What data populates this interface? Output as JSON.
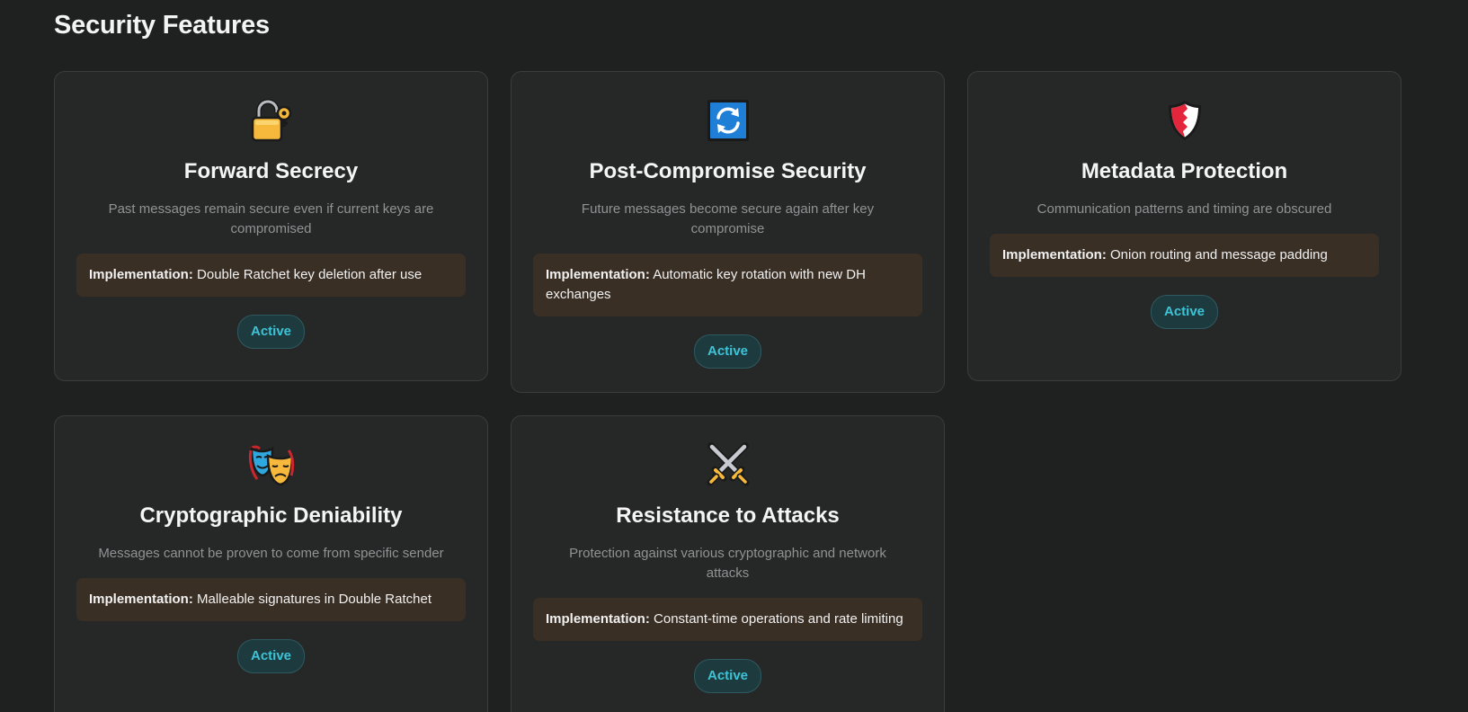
{
  "section": {
    "title": "Security Features"
  },
  "features": [
    {
      "icon": "unlocked-padlock-key-icon",
      "title": "Forward Secrecy",
      "description": "Past messages remain secure even if current keys are compromised",
      "impl_label": "Implementation:",
      "impl_text": "Double Ratchet key deletion after use",
      "status": "Active"
    },
    {
      "icon": "refresh-arrows-icon",
      "title": "Post-Compromise Security",
      "description": "Future messages become secure again after key compromise",
      "impl_label": "Implementation:",
      "impl_text": "Automatic key rotation with new DH exchanges",
      "status": "Active"
    },
    {
      "icon": "shield-icon",
      "title": "Metadata Protection",
      "description": "Communication patterns and timing are obscured",
      "impl_label": "Implementation:",
      "impl_text": "Onion routing and message padding",
      "status": "Active"
    },
    {
      "icon": "theater-masks-icon",
      "title": "Cryptographic Deniability",
      "description": "Messages cannot be proven to come from specific sender",
      "impl_label": "Implementation:",
      "impl_text": "Malleable signatures in Double Ratchet",
      "status": "Active"
    },
    {
      "icon": "crossed-swords-icon",
      "title": "Resistance to Attacks",
      "description": "Protection against various cryptographic and network attacks",
      "impl_label": "Implementation:",
      "impl_text": "Constant-time operations and rate limiting",
      "status": "Active"
    }
  ],
  "colors": {
    "background": "#1f2020",
    "card": "#262727",
    "implementation_box": "#3a2f25",
    "badge_text": "#3ec3d6",
    "badge_bg": "#1d3b3f"
  }
}
